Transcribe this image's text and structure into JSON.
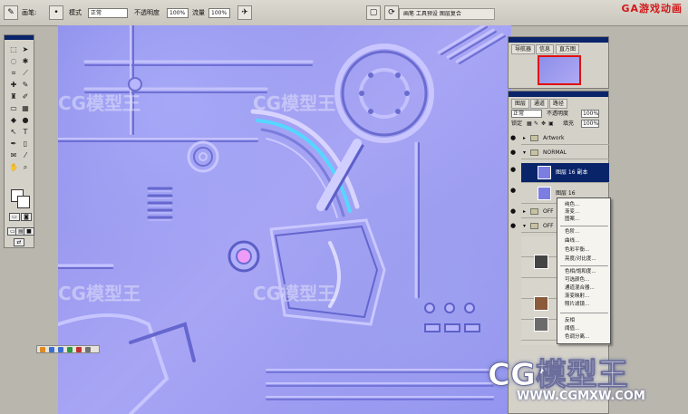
{
  "app": {
    "brand": "GA游戏动画"
  },
  "options_bar": {
    "mode_label": "模式",
    "mode_value": "正常",
    "opacity_label": "不透明度",
    "opacity_value": "100%",
    "flow_label": "流量",
    "flow_value": "100%",
    "palette_well_text": "画笔 工具预设 图层复合"
  },
  "navigator_panel": {
    "tabs": [
      "导航器",
      "信息",
      "直方图"
    ]
  },
  "layers_panel": {
    "tabs": [
      "图层",
      "通道",
      "路径"
    ],
    "blend_mode": "正常",
    "opacity_label": "不透明度",
    "opacity_value": "100%",
    "lock_label": "锁定",
    "fill_label": "填充",
    "fill_value": "100%",
    "layers": [
      {
        "name": "Artwork",
        "type": "group"
      },
      {
        "name": "NORMAL",
        "type": "group"
      },
      {
        "name": "图层 16 副本",
        "type": "layer",
        "selected": true
      },
      {
        "name": "图层 16",
        "type": "layer",
        "selected": false
      },
      {
        "name": "OFF",
        "type": "group"
      },
      {
        "name": "OFF",
        "type": "group"
      }
    ]
  },
  "context_menu": {
    "items": [
      "纯色...",
      "渐变...",
      "图案...",
      "色阶...",
      "曲线...",
      "色彩平衡...",
      "亮度/对比度...",
      "色相/饱和度...",
      "可选颜色...",
      "通道混合器...",
      "渐变映射...",
      "照片滤镜...",
      "反相",
      "阈值...",
      "色调分离..."
    ]
  },
  "watermarks": {
    "text": "CG模型王",
    "url": "WWW.CGMXW.COM"
  },
  "colors": {
    "selection": "#0a246a",
    "panel": "#d4d1c8",
    "canvas_base": "#9a9cf0",
    "brand_red": "#d01818"
  }
}
